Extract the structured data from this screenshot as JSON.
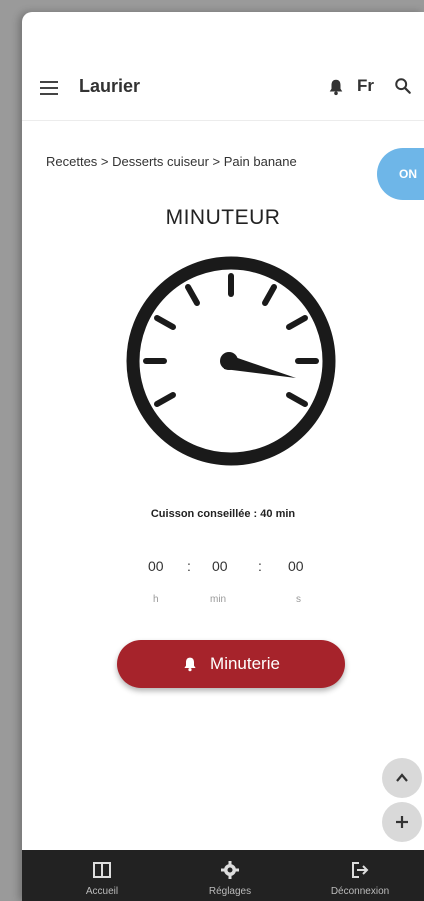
{
  "header": {
    "title": "Laurier",
    "language": "Fr"
  },
  "breadcrumb": "Recettes > Desserts cuiseur > Pain banane",
  "toggle": {
    "label": "ON"
  },
  "page_title": "MINUTEUR",
  "advice": "Cuisson conseillée : 40 min",
  "timer": {
    "hours": "00",
    "minutes": "00",
    "seconds": "00",
    "sep1": ":",
    "sep2": ":",
    "h_label": "h",
    "min_label": "min",
    "s_label": "s"
  },
  "minuterie_button": {
    "label": "Minuterie"
  },
  "float_buttons": {
    "up": "^",
    "add": "+"
  },
  "bottom_nav": [
    {
      "label": "Accueil",
      "icon": "book-icon"
    },
    {
      "label": "Réglages",
      "icon": "gear-icon"
    },
    {
      "label": "Déconnexion",
      "icon": "logout-icon"
    }
  ],
  "colors": {
    "accent": "#a6232b",
    "toggle": "#6eb6e8",
    "nav_bg": "#222222"
  }
}
